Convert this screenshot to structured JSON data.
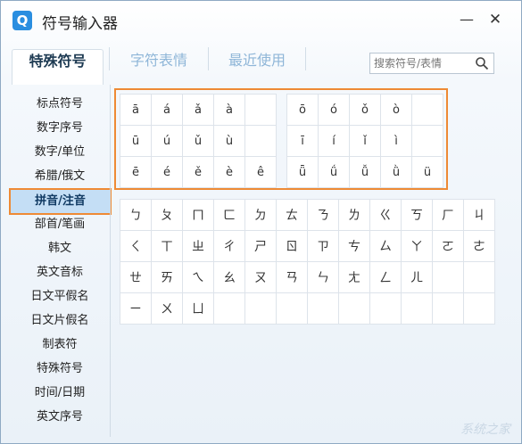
{
  "window": {
    "icon_glyph": "Q",
    "title": "符号输入器",
    "minimize_glyph": "—",
    "close_glyph": "✕"
  },
  "tabs": [
    {
      "label": "特殊符号",
      "active": true
    },
    {
      "label": "字符表情",
      "active": false
    },
    {
      "label": "最近使用",
      "active": false
    }
  ],
  "search": {
    "placeholder": "搜索符号/表情"
  },
  "sidebar": {
    "items": [
      {
        "label": "标点符号"
      },
      {
        "label": "数字序号"
      },
      {
        "label": "数字/单位"
      },
      {
        "label": "希腊/俄文"
      },
      {
        "label": "拼音/注音",
        "active": true
      },
      {
        "label": "部首/笔画"
      },
      {
        "label": "韩文"
      },
      {
        "label": "英文音标"
      },
      {
        "label": "日文平假名"
      },
      {
        "label": "日文片假名"
      },
      {
        "label": "制表符"
      },
      {
        "label": "特殊符号"
      },
      {
        "label": "时间/日期"
      },
      {
        "label": "英文序号"
      }
    ]
  },
  "pinyin_left": [
    [
      "ā",
      "á",
      "ǎ",
      "à",
      ""
    ],
    [
      "ū",
      "ú",
      "ǔ",
      "ù",
      ""
    ],
    [
      "ē",
      "é",
      "ě",
      "è",
      "ê"
    ]
  ],
  "pinyin_right": [
    [
      "ō",
      "ó",
      "ǒ",
      "ò",
      ""
    ],
    [
      "ī",
      "í",
      "ǐ",
      "ì",
      ""
    ],
    [
      "ǖ",
      "ǘ",
      "ǚ",
      "ǜ",
      "ü"
    ]
  ],
  "zhuyin": [
    [
      "ㄅ",
      "ㄆ",
      "ㄇ",
      "ㄈ",
      "ㄉ",
      "ㄊ",
      "ㄋ",
      "ㄌ",
      "ㄍ",
      "ㄎ",
      "ㄏ",
      "ㄐ"
    ],
    [
      "ㄑ",
      "ㄒ",
      "ㄓ",
      "ㄔ",
      "ㄕ",
      "ㄖ",
      "ㄗ",
      "ㄘ",
      "ㄙ",
      "ㄚ",
      "ㄛ",
      "ㄜ"
    ],
    [
      "ㄝ",
      "ㄞ",
      "ㄟ",
      "ㄠ",
      "ㄡ",
      "ㄢ",
      "ㄣ",
      "ㄤ",
      "ㄥ",
      "ㄦ",
      "",
      ""
    ],
    [
      "ㄧ",
      "ㄨ",
      "ㄩ",
      "",
      "",
      "",
      "",
      "",
      "",
      "",
      "",
      ""
    ]
  ],
  "watermark": "系统之家"
}
